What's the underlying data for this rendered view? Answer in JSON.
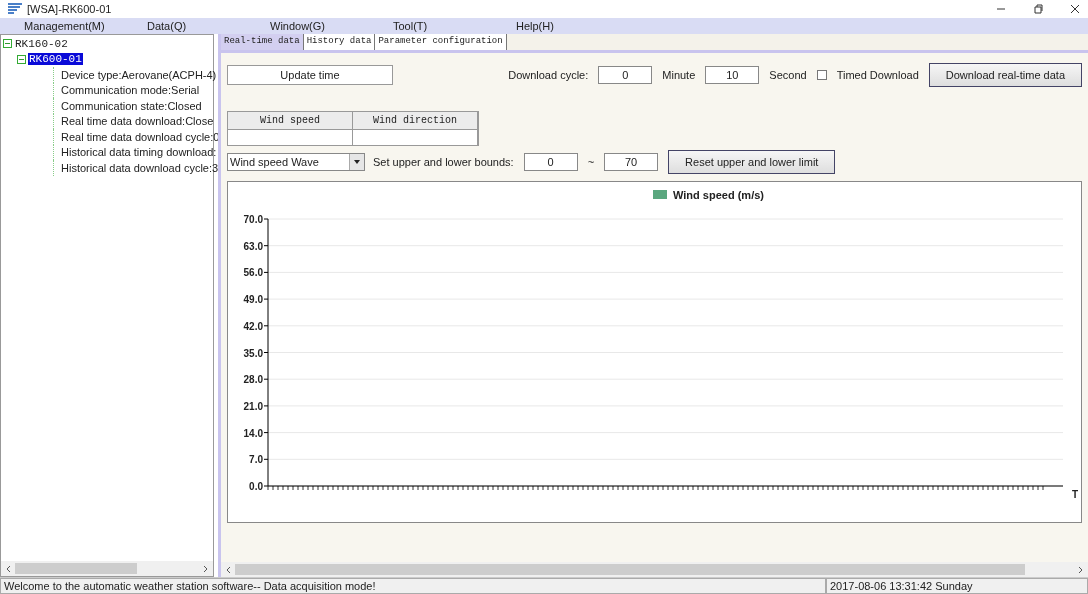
{
  "window": {
    "title": "[WSA]-RK600-01"
  },
  "menu": [
    "Management(M)",
    "Data(Q)",
    "Window(G)",
    "Tool(T)",
    "Help(H)"
  ],
  "tree": [
    {
      "label": "RK160-02",
      "expanded": true,
      "selected": false,
      "children": [
        {
          "label": "RK600-01",
          "expanded": true,
          "selected": true,
          "children": [
            {
              "label": "Device type:Aerovane(ACPH-4)"
            },
            {
              "label": "Communication mode:Serial"
            },
            {
              "label": "Communication state:Closed"
            },
            {
              "label": "Real time data download:Close"
            },
            {
              "label": "Real time data download cycle:0"
            },
            {
              "label": "Historical data timing download:"
            },
            {
              "label": "Historical data download cycle:3"
            }
          ]
        }
      ]
    }
  ],
  "tabs": [
    {
      "label": "Real-time data",
      "selected": true
    },
    {
      "label": "History data",
      "selected": false
    },
    {
      "label": "Parameter configuration",
      "selected": false
    }
  ],
  "update_time": {
    "label": "Update time"
  },
  "download": {
    "label": "Download cycle:",
    "minutes": "0",
    "minute_label": "Minute",
    "seconds": "10",
    "second_label": "Second",
    "timed_label": "Timed Download",
    "timed_checked": false,
    "button": "Download real-time data"
  },
  "readings": {
    "columns": [
      "Wind speed",
      "Wind direction"
    ]
  },
  "bounds": {
    "wave": "Wind speed Wave",
    "label": "Set upper and lower bounds:",
    "lower": "0",
    "separator": "~",
    "upper": "70",
    "button": "Reset upper and lower limit"
  },
  "chart": {
    "chart_data": {
      "type": "line",
      "ylim": [
        0,
        70
      ],
      "yticks": [
        {
          "value": 0,
          "label": "0.0"
        },
        {
          "value": 7,
          "label": "7.0"
        },
        {
          "value": 14,
          "label": "14.0"
        },
        {
          "value": 21,
          "label": "21.0"
        },
        {
          "value": 28,
          "label": "28.0"
        },
        {
          "value": 35,
          "label": "35.0"
        },
        {
          "value": 42,
          "label": "42.0"
        },
        {
          "value": 49,
          "label": "49.0"
        },
        {
          "value": 56,
          "label": "56.0"
        },
        {
          "value": 63,
          "label": "63.0"
        },
        {
          "value": 70,
          "label": "70.0"
        }
      ],
      "xlabel": "T",
      "grid": true,
      "series": [
        {
          "name": "Wind speed (m/s)",
          "color": "#5aa77f"
        }
      ]
    }
  },
  "status_bar": {
    "message": "Welcome to the automatic weather station software-- Data acquisition mode!",
    "datetime": "2017-08-06 13:31:42 Sunday"
  }
}
